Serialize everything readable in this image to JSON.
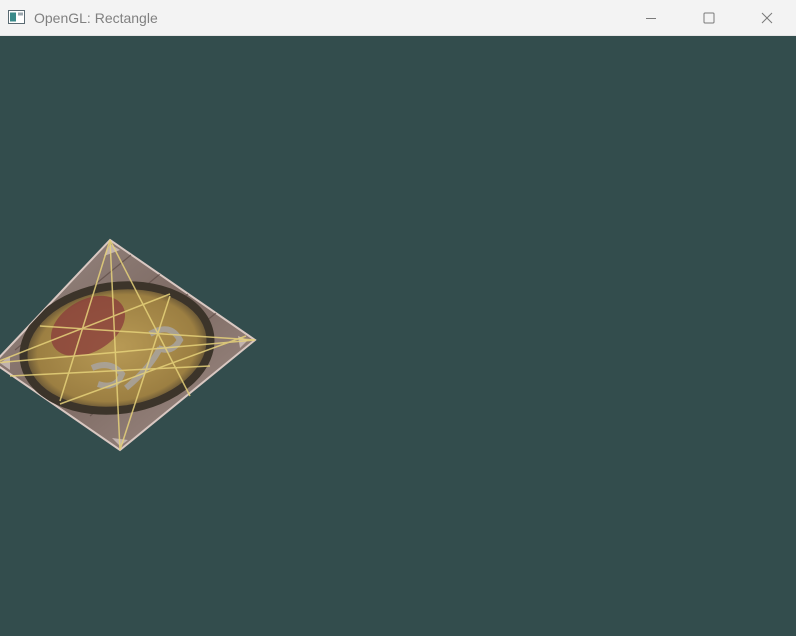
{
  "window": {
    "title": "OpenGL: Rectangle",
    "clear_color": "#334d4d",
    "titlebar_color": "#f3f3f3"
  },
  "titlebar": {
    "app_icon": "window-app-icon",
    "minimize_icon": "minimize-icon",
    "maximize_icon": "maximize-icon",
    "close_icon": "close-icon"
  },
  "scene": {
    "object": "textured-quad",
    "texture": "wooden-container-with-smiley-overlay",
    "wireframe_color": "#e6d27a"
  }
}
